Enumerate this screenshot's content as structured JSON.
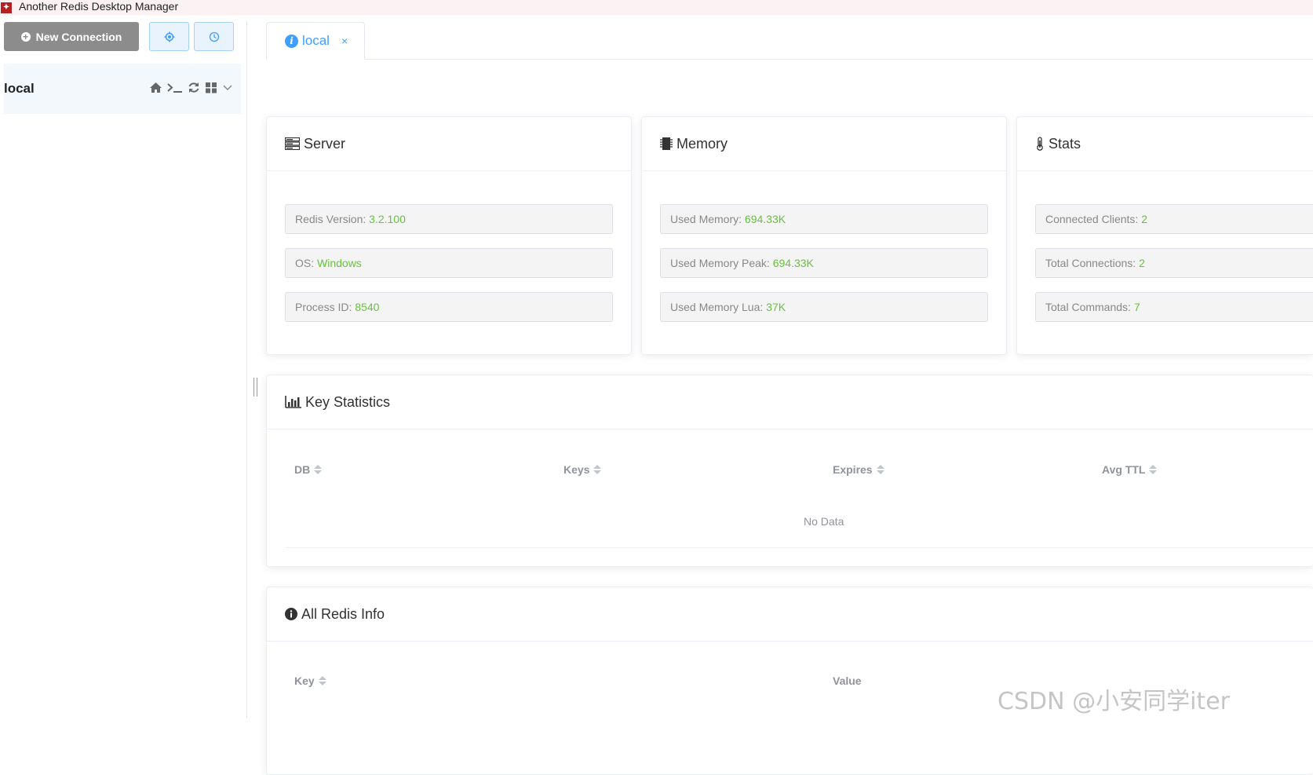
{
  "app": {
    "title": "Another Redis Desktop Manager"
  },
  "sidebar": {
    "new_connection_label": "New Connection",
    "connections": [
      {
        "name": "local"
      }
    ]
  },
  "tabs": [
    {
      "label": "local",
      "close": "×"
    }
  ],
  "cards": {
    "server": {
      "title": "Server",
      "items": [
        {
          "label": "Redis Version:",
          "value": "3.2.100"
        },
        {
          "label": "OS:",
          "value": "Windows"
        },
        {
          "label": "Process ID:",
          "value": "8540"
        }
      ]
    },
    "memory": {
      "title": "Memory",
      "items": [
        {
          "label": "Used Memory:",
          "value": "694.33K"
        },
        {
          "label": "Used Memory Peak:",
          "value": "694.33K"
        },
        {
          "label": "Used Memory Lua:",
          "value": "37K"
        }
      ]
    },
    "stats": {
      "title": "Stats",
      "items": [
        {
          "label": "Connected Clients:",
          "value": "2"
        },
        {
          "label": "Total Connections:",
          "value": "2"
        },
        {
          "label": "Total Commands:",
          "value": "7"
        }
      ]
    }
  },
  "key_statistics": {
    "title": "Key Statistics",
    "columns": [
      "DB",
      "Keys",
      "Expires",
      "Avg TTL"
    ],
    "empty_text": "No Data"
  },
  "all_redis_info": {
    "title": "All Redis Info",
    "columns": [
      "Key",
      "Value"
    ]
  },
  "watermark": "CSDN @小安同学iter",
  "colors": {
    "accent": "#409eff",
    "value_green": "#67c23a",
    "button_gray": "#8c8c8c"
  }
}
